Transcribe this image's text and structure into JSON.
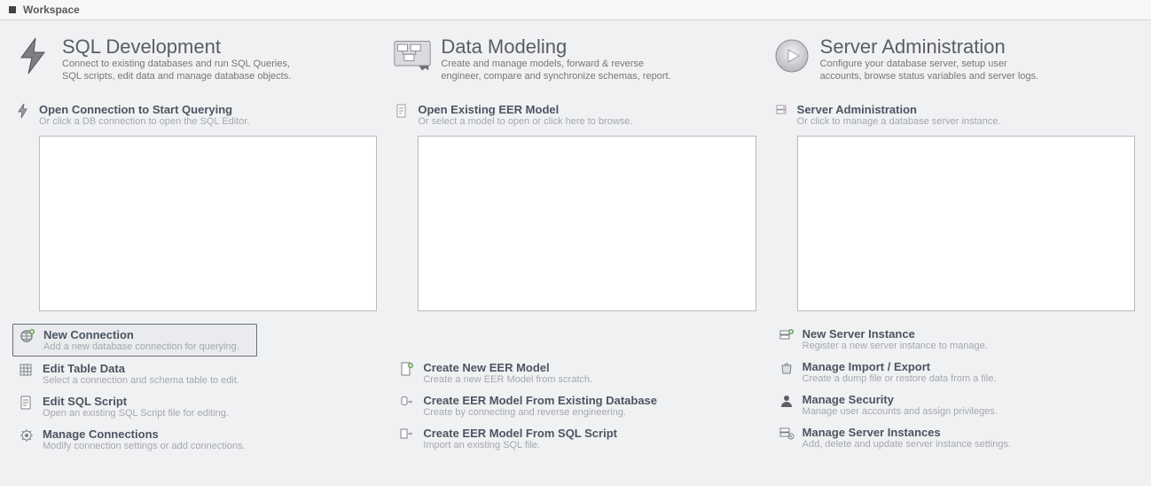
{
  "toolbar": {
    "title": "Workspace"
  },
  "columns": [
    {
      "category": {
        "title": "SQL Development",
        "desc": "Connect to existing databases and run SQL Queries, SQL scripts, edit data and manage database objects.",
        "icon": "bolt-icon"
      },
      "section": {
        "title": "Open Connection to Start Querying",
        "desc": "Or click a DB connection to open the SQL Editor.",
        "icon": "bolt-small-icon"
      },
      "actions": [
        {
          "title": "New Connection",
          "desc": "Add a new database connection for querying.",
          "icon": "globe-plus-icon",
          "selected": true
        },
        {
          "title": "Edit Table Data",
          "desc": "Select a connection and schema table to edit.",
          "icon": "table-edit-icon",
          "selected": false
        },
        {
          "title": "Edit SQL Script",
          "desc": "Open an existing SQL Script file for editing.",
          "icon": "script-edit-icon",
          "selected": false
        },
        {
          "title": "Manage Connections",
          "desc": "Modify connection settings or add connections.",
          "icon": "gear-link-icon",
          "selected": false
        }
      ]
    },
    {
      "category": {
        "title": "Data Modeling",
        "desc": "Create and manage models, forward & reverse engineer, compare and synchronize schemas, report.",
        "icon": "diagram-icon"
      },
      "section": {
        "title": "Open Existing EER Model",
        "desc": "Or select a model to open or click here to browse.",
        "icon": "document-icon"
      },
      "actions": [
        {
          "title": "Create New EER Model",
          "desc": "Create a new EER Model from scratch.",
          "icon": "document-plus-icon",
          "selected": false
        },
        {
          "title": "Create EER Model From Existing Database",
          "desc": "Create by connecting and reverse engineering.",
          "icon": "db-to-doc-icon",
          "selected": false
        },
        {
          "title": "Create EER Model From SQL Script",
          "desc": "Import an existing SQL file.",
          "icon": "script-to-doc-icon",
          "selected": false
        }
      ]
    },
    {
      "category": {
        "title": "Server Administration",
        "desc": "Configure your database server, setup user accounts, browse status variables and server logs.",
        "icon": "disc-play-icon"
      },
      "section": {
        "title": "Server Administration",
        "desc": "Or click to manage a database server instance.",
        "icon": "server-small-icon"
      },
      "actions": [
        {
          "title": "New Server Instance",
          "desc": "Register a new server instance to manage.",
          "icon": "server-plus-icon",
          "selected": false
        },
        {
          "title": "Manage Import / Export",
          "desc": "Create a dump file or restore data from a file.",
          "icon": "bag-icon",
          "selected": false
        },
        {
          "title": "Manage Security",
          "desc": "Manage user accounts and assign privileges.",
          "icon": "user-icon",
          "selected": false
        },
        {
          "title": "Manage Server Instances",
          "desc": "Add, delete and update server instance settings.",
          "icon": "server-gear-icon",
          "selected": false
        }
      ]
    }
  ]
}
